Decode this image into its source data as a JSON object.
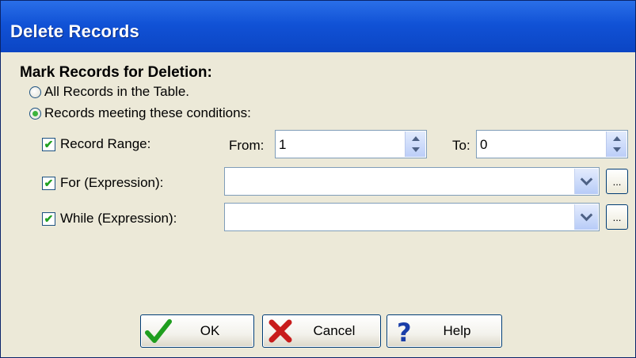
{
  "window": {
    "title": "Delete Records"
  },
  "section": {
    "label": "Mark Records for Deletion:"
  },
  "radios": [
    {
      "label": "All Records in the Table.",
      "checked": false
    },
    {
      "label": "Records meeting these conditions:",
      "checked": true
    }
  ],
  "record_range": {
    "label": "Record Range:",
    "checked": true,
    "from_label": "From:",
    "from_value": "1",
    "to_label": "To:",
    "to_value": "0"
  },
  "for_expr": {
    "label": "For (Expression):",
    "checked": true,
    "value": "",
    "ellipsis": "..."
  },
  "while_expr": {
    "label": "While (Expression):",
    "checked": true,
    "value": "",
    "ellipsis": "..."
  },
  "buttons": {
    "ok": {
      "label": "OK",
      "icon": "checkmark-icon",
      "color": "#1f9e1f"
    },
    "cancel": {
      "label": "Cancel",
      "icon": "x-icon",
      "color": "#c81c1c"
    },
    "help": {
      "label": "Help",
      "icon": "question-mark-icon",
      "color": "#1a3ea8"
    }
  },
  "colors": {
    "titlebar": "#1152d6",
    "dialog_bg": "#ece9d8",
    "check_green": "#21a121"
  }
}
